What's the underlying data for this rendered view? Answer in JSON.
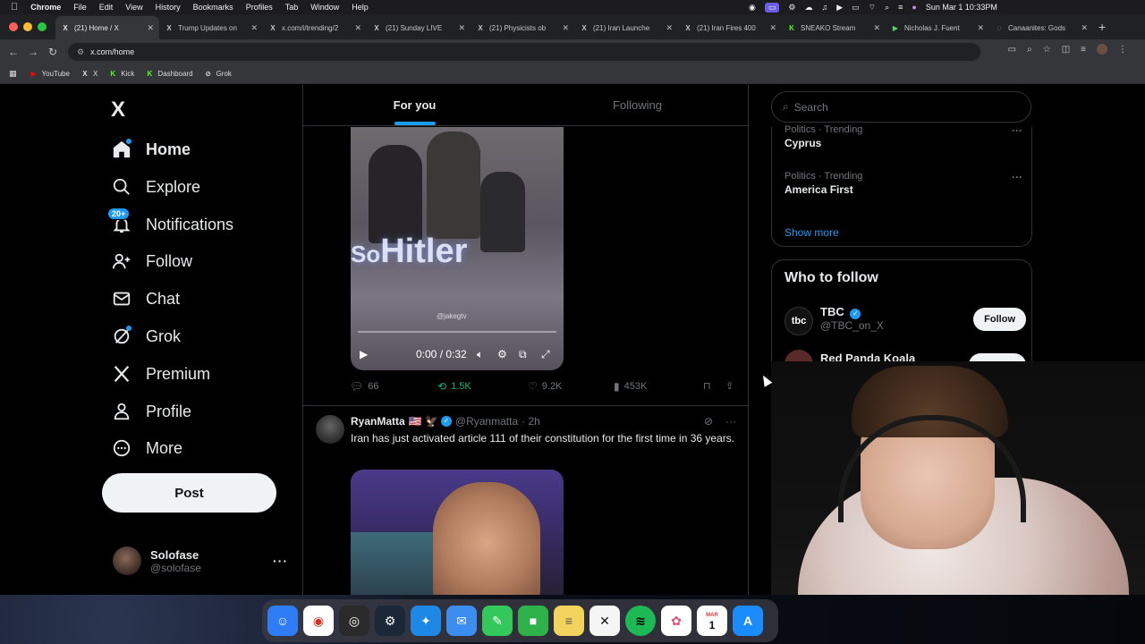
{
  "macbar": {
    "apple": "",
    "app": "Chrome",
    "menus": [
      "File",
      "Edit",
      "View",
      "History",
      "Bookmarks",
      "Profiles",
      "Tab",
      "Window",
      "Help"
    ],
    "datetime": "Sun Mar 1  10:33PM"
  },
  "tabs": [
    {
      "title": "(21) Home / X",
      "fav": "X",
      "favcolor": "#e8eaed"
    },
    {
      "title": "Trump Updates on",
      "fav": "X",
      "favcolor": "#e8eaed"
    },
    {
      "title": "x.com/i/trending/2",
      "fav": "X",
      "favcolor": "#e8eaed"
    },
    {
      "title": "(21) Sunday LIVE",
      "fav": "X",
      "favcolor": "#e8eaed"
    },
    {
      "title": "(21) Physicists ob",
      "fav": "X",
      "favcolor": "#e8eaed"
    },
    {
      "title": "(21) Iran Launche",
      "fav": "X",
      "favcolor": "#e8eaed"
    },
    {
      "title": "(21) Iran Fires 400",
      "fav": "X",
      "favcolor": "#e8eaed"
    },
    {
      "title": "SNEAKO Stream",
      "fav": "K",
      "favcolor": "#53fc18"
    },
    {
      "title": "Nicholas J. Fuent",
      "fav": "▶",
      "favcolor": "#5fd35f"
    },
    {
      "title": "Canaanites: Gods",
      "fav": "◌",
      "favcolor": "#e8eaed"
    }
  ],
  "address": {
    "url": "x.com/home"
  },
  "bookmarks": [
    {
      "label": "YouTube",
      "fav": "▶",
      "color": "#ff0000"
    },
    {
      "label": "X",
      "fav": "X",
      "color": "#e8eaed"
    },
    {
      "label": "Kick",
      "fav": "K",
      "color": "#53fc18"
    },
    {
      "label": "Dashboard",
      "fav": "K",
      "color": "#53fc18"
    },
    {
      "label": "Grok",
      "fav": "⊘",
      "color": "#e8eaed"
    }
  ],
  "nav": {
    "logo": "X",
    "items": [
      {
        "label": "Home"
      },
      {
        "label": "Explore"
      },
      {
        "label": "Notifications",
        "badge": "20+"
      },
      {
        "label": "Follow"
      },
      {
        "label": "Chat"
      },
      {
        "label": "Grok"
      },
      {
        "label": "Premium"
      },
      {
        "label": "Profile"
      },
      {
        "label": "More"
      }
    ],
    "post_label": "Post",
    "account": {
      "name": "Solofase",
      "handle": "@solofase",
      "more": "···"
    }
  },
  "feed": {
    "tabs": [
      {
        "label": "For you"
      },
      {
        "label": "Following"
      }
    ],
    "tweet1": {
      "video": {
        "caption_small": "So",
        "caption": "Hitler",
        "watermark": "@jakegtv",
        "time": "0:00 / 0:32",
        "progress": 0
      },
      "replies": "66",
      "reposts": "1.5K",
      "likes": "9.2K",
      "views": "453K"
    },
    "tweet2": {
      "name": "RyanMatta",
      "flag": "🇺🇸 🦅",
      "handle": "@Ryanmatta",
      "time": "· 2h",
      "text": "Iran has just activated article 111 of their constitution for the first time in 36 years."
    }
  },
  "sidebar": {
    "search_placeholder": "Search",
    "trends": [
      {
        "category": "Politics · Trending",
        "name": "Cyprus"
      },
      {
        "category": "Politics · Trending",
        "name": "America First"
      }
    ],
    "show_more": "Show more",
    "who_to_follow": {
      "title": "Who to follow",
      "items": [
        {
          "name": "TBC",
          "handle": "@TBC_on_X",
          "avatar": "tbc",
          "button": "Follow"
        },
        {
          "name": "Red Panda Koala"
        }
      ]
    }
  },
  "dock": {
    "apps": [
      {
        "name": "Finder",
        "color": "#2e7cf6",
        "glyph": "☺"
      },
      {
        "name": "Chrome",
        "color": "#ffffff",
        "glyph": "◉"
      },
      {
        "name": "OBS",
        "color": "#2a2a2a",
        "glyph": "◎"
      },
      {
        "name": "Steam",
        "color": "#1b2838",
        "glyph": "⚙"
      },
      {
        "name": "Safari",
        "color": "#1e88e5",
        "glyph": "✦"
      },
      {
        "name": "Mail",
        "color": "#3b8ef0",
        "glyph": "✉"
      },
      {
        "name": "Messages",
        "color": "#34c759",
        "glyph": "✎"
      },
      {
        "name": "FaceTime",
        "color": "#30b24a",
        "glyph": "■"
      },
      {
        "name": "Notes",
        "color": "#f2d45c",
        "glyph": "≡"
      },
      {
        "name": "CapCut",
        "color": "#111111",
        "glyph": "✕"
      },
      {
        "name": "Spotify",
        "color": "#1db954",
        "glyph": "≋"
      },
      {
        "name": "Photos",
        "color": "#ffffff",
        "glyph": "✿"
      },
      {
        "name": "Calendar",
        "color": "#ffffff",
        "glyph": "1"
      },
      {
        "name": "App Store",
        "color": "#1a8cff",
        "glyph": "A"
      }
    ],
    "calendar_month": "MAR"
  }
}
